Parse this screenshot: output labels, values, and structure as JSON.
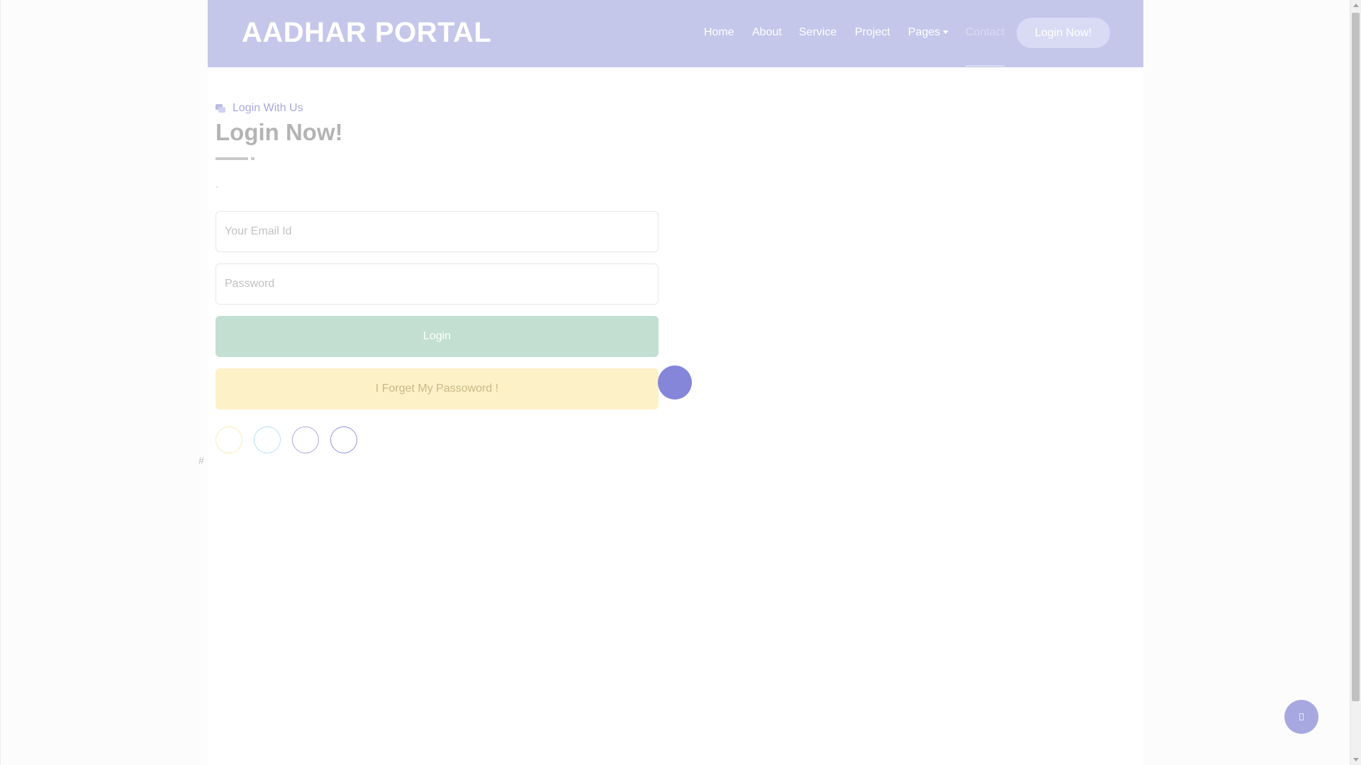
{
  "navbar": {
    "brand": "AADHAR PORTAL",
    "items": [
      {
        "label": "Home"
      },
      {
        "label": "About"
      },
      {
        "label": "Service"
      },
      {
        "label": "Project"
      },
      {
        "label": "Pages"
      },
      {
        "label": "Contact",
        "active": true
      }
    ],
    "cta_label": "Login Now!"
  },
  "section": {
    "subtitle": "Login With Us",
    "subtitle_icon": "chat-bubbles-icon",
    "title": "Login Now!",
    "dot_text": "."
  },
  "form": {
    "email_placeholder": "Your Email Id",
    "password_placeholder": "Password",
    "login_label": "Login",
    "forgot_label": "I Forget My Passoword !"
  },
  "social_icons": [
    "facebook-icon",
    "twitter-icon",
    "linkedin-icon",
    "instagram-icon"
  ],
  "footer_hash": "#",
  "colors": {
    "navbar_bg": "#c4c6ea",
    "accent": "#8586d9",
    "login_button": "#c3dfd2",
    "forgot_button": "#fdf1c8",
    "social_borders": [
      "#f6ecb4",
      "#b5e2f2",
      "#a9aade",
      "#9495d6"
    ]
  }
}
